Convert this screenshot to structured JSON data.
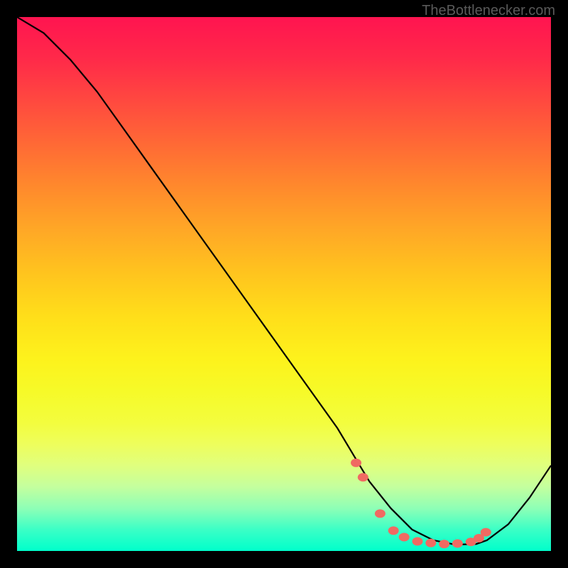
{
  "watermark": "TheBottlenecker.com",
  "chart_data": {
    "type": "line",
    "title": "",
    "xlabel": "",
    "ylabel": "",
    "xlim": [
      0,
      100
    ],
    "ylim": [
      0,
      100
    ],
    "series": [
      {
        "name": "curve",
        "x": [
          0,
          5,
          10,
          15,
          20,
          25,
          30,
          35,
          40,
          45,
          50,
          55,
          60,
          63,
          66,
          70,
          74,
          78,
          82,
          86,
          88,
          92,
          96,
          100
        ],
        "y": [
          100,
          97,
          92,
          86,
          79,
          72,
          65,
          58,
          51,
          44,
          37,
          30,
          23,
          18,
          13,
          8,
          4,
          2,
          1.2,
          1.3,
          2,
          5,
          10,
          16
        ]
      }
    ],
    "markers": {
      "name": "points",
      "color": "#f06a62",
      "x": [
        63.5,
        64.8,
        68.0,
        70.5,
        72.5,
        75.0,
        77.5,
        80.0,
        82.5,
        85.0,
        86.5,
        87.8
      ],
      "y": [
        16.5,
        13.8,
        7.0,
        3.8,
        2.6,
        1.8,
        1.5,
        1.3,
        1.4,
        1.7,
        2.4,
        3.5
      ]
    }
  }
}
